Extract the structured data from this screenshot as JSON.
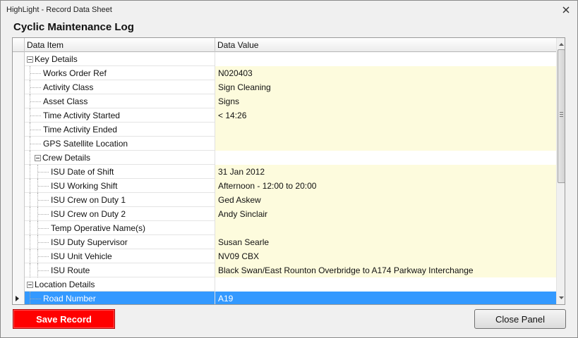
{
  "window": {
    "title": "HighLight - Record Data Sheet"
  },
  "panel": {
    "title": "Cyclic Maintenance Log"
  },
  "grid": {
    "columns": {
      "item": "Data Item",
      "value": "Data Value"
    },
    "rows": [
      {
        "type": "group",
        "level": 0,
        "label": "Key Details",
        "value": ""
      },
      {
        "type": "field",
        "level": 1,
        "label": "Works Order Ref",
        "value": "N020403"
      },
      {
        "type": "field",
        "level": 1,
        "label": "Activity Class",
        "value": "Sign Cleaning"
      },
      {
        "type": "field",
        "level": 1,
        "label": "Asset Class",
        "value": "Signs"
      },
      {
        "type": "field",
        "level": 1,
        "label": "Time Activity Started",
        "value": "< 14:26"
      },
      {
        "type": "field",
        "level": 1,
        "label": "Time Activity Ended",
        "value": ""
      },
      {
        "type": "field",
        "level": 1,
        "label": "GPS Satellite Location",
        "value": ""
      },
      {
        "type": "group",
        "level": 1,
        "label": "Crew Details",
        "value": ""
      },
      {
        "type": "field",
        "level": 2,
        "label": "ISU Date of Shift",
        "value": "31 Jan 2012"
      },
      {
        "type": "field",
        "level": 2,
        "label": "ISU Working Shift",
        "value": "Afternoon - 12:00 to 20:00"
      },
      {
        "type": "field",
        "level": 2,
        "label": "ISU Crew on Duty 1",
        "value": "Ged Askew"
      },
      {
        "type": "field",
        "level": 2,
        "label": "ISU Crew on Duty 2",
        "value": "Andy Sinclair"
      },
      {
        "type": "field",
        "level": 2,
        "label": "Temp Operative Name(s)",
        "value": ""
      },
      {
        "type": "field",
        "level": 2,
        "label": "ISU Duty Supervisor",
        "value": "Susan Searle"
      },
      {
        "type": "field",
        "level": 2,
        "label": "ISU Unit Vehicle",
        "value": "NV09 CBX"
      },
      {
        "type": "field",
        "level": 2,
        "label": "ISU Route",
        "value": "Black Swan/East Rounton Overbridge to A174 Parkway Interchange"
      },
      {
        "type": "group",
        "level": 0,
        "label": "Location Details",
        "value": ""
      },
      {
        "type": "field",
        "level": 1,
        "label": "Road Number",
        "value": "A19",
        "selected": true
      }
    ]
  },
  "buttons": {
    "save": "Save Record",
    "close": "Close Panel"
  },
  "colors": {
    "save_button": "#ff0000",
    "selected_row": "#3399ff",
    "value_cell": "#fdfbdd"
  }
}
